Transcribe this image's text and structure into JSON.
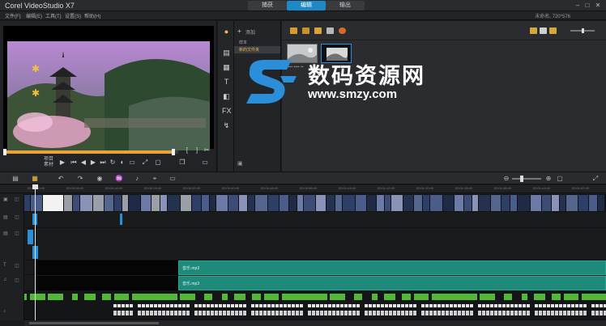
{
  "window": {
    "title": "Corel VideoStudio X7",
    "steps": [
      "捕获",
      "编辑",
      "输出"
    ],
    "active_step": 1,
    "controls": [
      "–",
      "□",
      "✕"
    ]
  },
  "menu": {
    "items": [
      "文件(F)",
      "编辑(E)",
      "工具(T)",
      "设置(S)",
      "帮助(H)"
    ],
    "project_info": "未命名, 720*576"
  },
  "player": {
    "progress": 0.98,
    "mode_label_1": "项目",
    "mode_label_2": "素材",
    "controls": [
      "home-icon",
      "prev-frame-icon",
      "play-icon",
      "start-icon",
      "back-icon",
      "next-icon",
      "end-icon",
      "repeat-icon",
      "volume-icon",
      "fullscreen-icon"
    ]
  },
  "library": {
    "add_label": "添加",
    "folders": [
      "样本",
      "新的文件夹"
    ],
    "thumbnails": [
      "image-thumbnail",
      "video-thumbnail"
    ]
  },
  "watermark": {
    "brand": "数码资源网",
    "url": "www.smzy.com"
  },
  "timeline": {
    "clips": [
      {
        "track": 4,
        "label": "音乐.mp3"
      },
      {
        "track": 5,
        "label": "音乐.mp3"
      }
    ],
    "ruler": [
      "00:00:00:00",
      "00:00:08:00",
      "00:00:16:00",
      "00:00:24:00",
      "00:00:32:00",
      "00:00:40:00",
      "00:00:48:00",
      "00:00:56:00",
      "00:01:04:00",
      "00:01:12:00",
      "00:01:20:00",
      "00:01:28:00",
      "00:01:36:00",
      "00:01:44:00",
      "00:01:52:00"
    ]
  },
  "colors": {
    "accent": "#1e88c8",
    "audio_clip": "#1d8a7a",
    "scrubber": "#e8a23a",
    "waveform": "#53b836"
  }
}
